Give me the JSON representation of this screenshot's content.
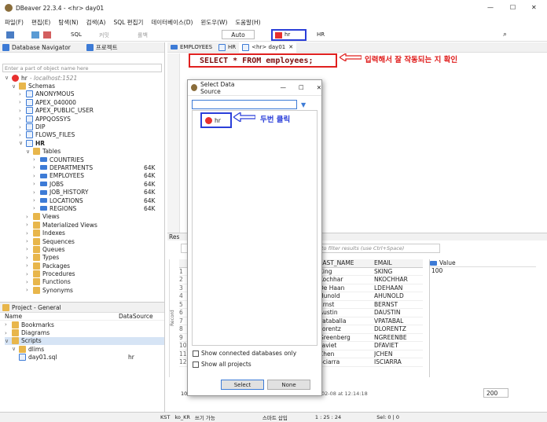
{
  "window": {
    "title": "DBeaver 22.3.4 - <hr> day01",
    "min": "—",
    "max": "☐",
    "close": "✕"
  },
  "menu": [
    "파일(F)",
    "편집(E)",
    "탐색(N)",
    "검색(A)",
    "SQL 편집기",
    "데이터베이스(D)",
    "윈도우(W)",
    "도움말(H)"
  ],
  "toolbar": {
    "sql": "SQL",
    "commit": "커밋",
    "rollback": "롤백",
    "mode": "Auto",
    "datasource": "hr",
    "schema": "HR"
  },
  "navigator": {
    "tab1": "Database Navigator",
    "tab2": "프로젝트",
    "filter_placeholder": "Enter a part of object name here",
    "connection": "hr",
    "connection_host": "- localhost:1521",
    "schemas": "Schemas",
    "schema_items": [
      "ANONYMOUS",
      "APEX_040000",
      "APEX_PUBLIC_USER",
      "APPQOSSYS",
      "DIP",
      "FLOWS_FILES"
    ],
    "hr": "HR",
    "tables": "Tables",
    "table_items": [
      {
        "name": "COUNTRIES",
        "size": ""
      },
      {
        "name": "DEPARTMENTS",
        "size": "64K"
      },
      {
        "name": "EMPLOYEES",
        "size": "64K"
      },
      {
        "name": "JOBS",
        "size": "64K"
      },
      {
        "name": "JOB_HISTORY",
        "size": "64K"
      },
      {
        "name": "LOCATIONS",
        "size": "64K"
      },
      {
        "name": "REGIONS",
        "size": "64K"
      }
    ],
    "other_items": [
      "Views",
      "Materialized Views",
      "Indexes",
      "Sequences",
      "Queues",
      "Types",
      "Packages",
      "Procedures",
      "Functions",
      "Synonyms"
    ]
  },
  "project": {
    "tab": "Project - General",
    "col1": "Name",
    "col2": "DataSource",
    "items": [
      "Bookmarks",
      "Diagrams",
      "Scripts"
    ],
    "folder": "dlims",
    "file": "day01.sql",
    "file_ds": "hr"
  },
  "editor": {
    "tab1": "EMPLOYEES",
    "tab2": "HR",
    "tab3": "<hr> day01",
    "sql": "SELECT * FROM employees;",
    "annotation1": "입력해서 잘 작동되는 지 확인",
    "annotation2": "두번 클릭"
  },
  "dialog": {
    "title": "Select Data Source",
    "item": "hr",
    "chk1": "Show connected databases only",
    "chk2": "Show all projects",
    "select": "Select",
    "none": "None"
  },
  "results": {
    "tab": "Res",
    "filter_placeholder": "to filter results (use Ctrl+Space)",
    "col_last": "LAST_NAME",
    "col_email": "EMAIL",
    "rows": [
      [
        "King",
        "SKING"
      ],
      [
        "Kochhar",
        "NKOCHHAR"
      ],
      [
        "De Haan",
        "LDEHAAN"
      ],
      [
        "Hunold",
        "AHUNOLD"
      ],
      [
        "Ernst",
        "BERNST"
      ],
      [
        "Austin",
        "DAUSTIN"
      ],
      [
        "Pataballa",
        "VPATABAL"
      ],
      [
        "Lorentz",
        "DLORENTZ"
      ],
      [
        "Greenberg",
        "NGREENBE"
      ],
      [
        "Faviet",
        "DFAVIET"
      ],
      [
        "Chen",
        "JCHEN"
      ],
      [
        "Sciarra",
        "ISCIARRA"
      ]
    ],
    "row_nums": [
      "1",
      "2",
      "3",
      "4",
      "5",
      "6",
      "7",
      "8",
      "9",
      "10",
      "11",
      "12"
    ],
    "value_tab": "Value",
    "value": "100",
    "status": "107 row(s) fetched - 3ms (2ms fetch), on 2023-02-08 at 12:14:18",
    "count": "107",
    "limit": "200",
    "sidebar_label": "Record"
  },
  "statusbar": [
    "KST",
    "ko_KR",
    "쓰기 가능",
    "스마트 삽입",
    "1 : 25 : 24",
    "Sel: 0 | 0"
  ]
}
